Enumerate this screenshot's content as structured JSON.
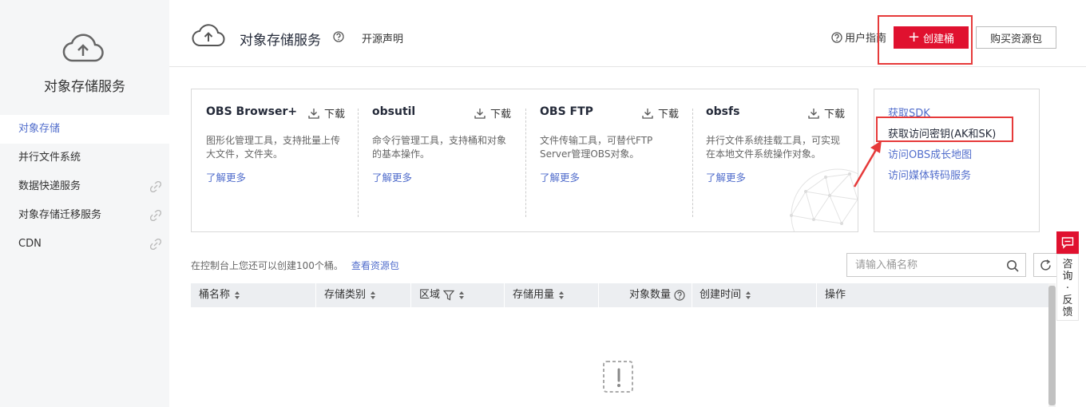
{
  "sidebar": {
    "title": "对象存储服务",
    "items": [
      {
        "label": "对象存储",
        "active": true
      },
      {
        "label": "并行文件系统"
      },
      {
        "label": "数据快递服务",
        "external": true
      },
      {
        "label": "对象存储迁移服务",
        "external": true
      },
      {
        "label": "CDN",
        "external": true
      }
    ]
  },
  "header": {
    "title": "对象存储服务",
    "open_source": "开源声明",
    "guide": "用户指南",
    "create_label": "创建桶",
    "buy_label": "购买资源包"
  },
  "tools": [
    {
      "name": "OBS Browser+",
      "download": "下载",
      "desc": "图形化管理工具，支持批量上传大文件，文件夹。",
      "more": "了解更多"
    },
    {
      "name": "obsutil",
      "download": "下载",
      "desc": "命令行管理工具，支持桶和对象的基本操作。",
      "more": "了解更多"
    },
    {
      "name": "OBS FTP",
      "download": "下载",
      "desc": "文件传输工具，可替代FTP Server管理OBS对象。",
      "more": "了解更多"
    },
    {
      "name": "obsfs",
      "download": "下载",
      "desc": "并行文件系统挂载工具，可实现在本地文件系统操作对象。",
      "more": "了解更多"
    }
  ],
  "links": [
    "获取SDK",
    "获取访问密钥(AK和SK)",
    "访问OBS成长地图",
    "访问媒体转码服务"
  ],
  "quota": {
    "text": "在控制台上您还可以创建100个桶。",
    "link": "查看资源包"
  },
  "search": {
    "placeholder": "请输入桶名称",
    "value": ""
  },
  "table": {
    "columns": [
      "桶名称",
      "存储类别",
      "区域",
      "存储用量",
      "对象数量",
      "创建时间",
      "操作"
    ]
  },
  "consult": {
    "label": "咨询·反馈"
  },
  "colors": {
    "accent": "#e0112f",
    "link": "#526ecc",
    "annotation": "#e63a3a"
  }
}
